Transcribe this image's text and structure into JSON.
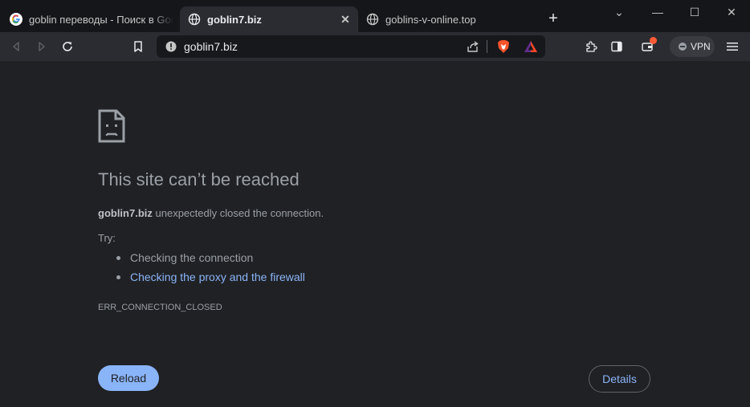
{
  "tabs": [
    {
      "title": "goblin переводы - Поиск в Google",
      "favicon": "google-icon",
      "active": false
    },
    {
      "title": "goblin7.biz",
      "favicon": "globe-icon",
      "active": true
    },
    {
      "title": "goblins-v-online.top",
      "favicon": "globe-icon",
      "active": false
    }
  ],
  "tab_close_glyph": "✕",
  "new_tab_glyph": "+",
  "window_controls": {
    "dropdown": "⌄",
    "minimize": "—",
    "maximize": "☐",
    "close": "✕"
  },
  "toolbar": {
    "url": "goblin7.biz",
    "vpn_label": "VPN",
    "icons": [
      "back-icon",
      "forward-icon",
      "reload-icon",
      "bookmark-icon",
      "site-info-icon",
      "share-icon",
      "brave-shields-icon",
      "brave-rewards-icon",
      "extensions-icon",
      "sidebar-icon",
      "wallet-icon",
      "menu-icon"
    ]
  },
  "error": {
    "heading": "This site can’t be reached",
    "host": "goblin7.biz",
    "message": " unexpectedly closed the connection.",
    "try_label": "Try:",
    "suggestions": [
      "Checking the connection",
      "Checking the proxy and the firewall"
    ],
    "code": "ERR_CONNECTION_CLOSED",
    "reload_label": "Reload",
    "details_label": "Details"
  },
  "colors": {
    "accent": "#8ab4f8",
    "background": "#202124",
    "text": "#9aa0a6"
  }
}
